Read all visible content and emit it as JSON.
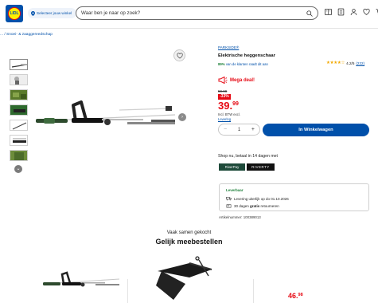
{
  "header": {
    "logo_text": "LIDL",
    "store_selector": "Selecteer jouw winkel",
    "search_placeholder": "Waar ben je naar op zoek?"
  },
  "breadcrumb": "... / Snoei- & zaaggereedschap",
  "product": {
    "brand": "PARKSIDE®",
    "title": "Elektrische heggenschaar",
    "rating_value": "4.2/5",
    "rating_count": "(222)",
    "recommend_percent": "89%",
    "recommend_text": "van de klanten raadt dit aan",
    "mega_deal": "Mega deal!",
    "old_price": "59.99",
    "discount": "-33%",
    "price_main": "39.",
    "price_cents": "99",
    "vat_text": "Incl. BTW excl.",
    "delivery_link": "Levering",
    "quantity": "1",
    "qty_minus": "−",
    "qty_plus": "+",
    "cart_button": "In Winkelwagen",
    "shop_now": "Shop nu, betaal in 14 dagen met",
    "pay_option_1": "RiverPay",
    "pay_option_2": "RIVERTY",
    "availability": "Leverbaar",
    "delivery_line": "Levering uiterlijk op do 01.10.2026",
    "returns_pre": "30 dagen ",
    "returns_bold": "gratis",
    "returns_post": " retourneren",
    "article_number": "Artikelnummer: 100389013"
  },
  "recommendations": {
    "subtitle": "Vaak samen gekocht",
    "title": "Gelijk meebestellen",
    "price_main": "46.",
    "price_cents": "98"
  },
  "colors": {
    "brand_blue": "#0050aa",
    "price_red": "#e60a14",
    "logo_yellow": "#fff000"
  }
}
